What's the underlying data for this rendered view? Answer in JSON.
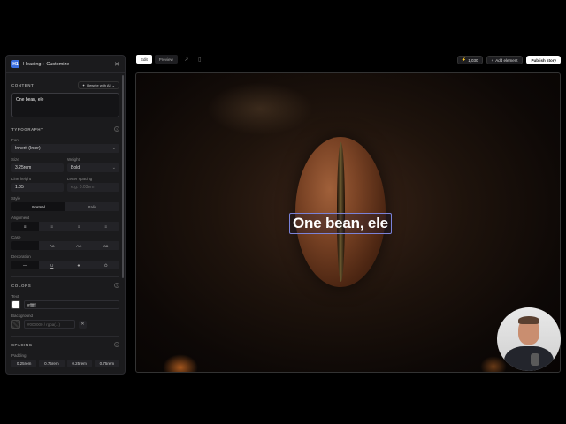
{
  "panel": {
    "breadcrumb_parent": "Heading",
    "breadcrumb_sep": "›",
    "breadcrumb_current": "Customize",
    "badge": "H1",
    "close": "✕"
  },
  "content": {
    "section": "CONTENT",
    "rewrite_label": "Rewrite with AI",
    "text_value": "One bean, ele"
  },
  "typography": {
    "section": "TYPOGRAPHY",
    "font_label": "Font",
    "font_value": "Inherit (Inter)",
    "size_label": "Size",
    "size_value": "3.25rem",
    "weight_label": "Weight",
    "weight_value": "Bold",
    "line_height_label": "Line height",
    "line_height_value": "1.05",
    "letter_spacing_label": "Letter spacing",
    "letter_spacing_placeholder": "e.g. 0.03em",
    "style_label": "Style",
    "style_options": [
      "Normal",
      "Italic"
    ],
    "alignment_label": "Alignment",
    "alignment_options": [
      "≡",
      "≡",
      "≡",
      "≡"
    ],
    "case_label": "Case",
    "case_options": [
      "—",
      "Aa",
      "AA",
      "aa"
    ],
    "decoration_label": "Decoration",
    "decoration_options": [
      "—",
      "U",
      "S",
      "Ō"
    ]
  },
  "colors": {
    "section": "COLORS",
    "text_label": "Text",
    "text_value": "#ffffff",
    "text_color": "#ffffff",
    "background_label": "Background",
    "background_placeholder": "#000000 / rgba(...)",
    "clear": "✕"
  },
  "spacing": {
    "section": "SPACING",
    "padding_label": "Padding",
    "padding_values": [
      "0.25rem",
      "0.75rem",
      "0.25rem",
      "0.75rem"
    ]
  },
  "toolbar": {
    "edit_label": "Edit",
    "preview_label": "Preview",
    "credits_value": "1,030",
    "add_element_label": "Add element",
    "publish_label": "Publish story"
  },
  "canvas": {
    "heading_text": "One bean, ele"
  },
  "icons": {
    "close": "close-icon",
    "sparkle": "sparkle-icon",
    "help": "help-icon",
    "chevron": "chevron-down-icon",
    "external": "external-link-icon",
    "mobile": "mobile-icon",
    "bolt": "bolt-icon",
    "plus": "plus-icon"
  },
  "accent_color": "#7a82d8"
}
